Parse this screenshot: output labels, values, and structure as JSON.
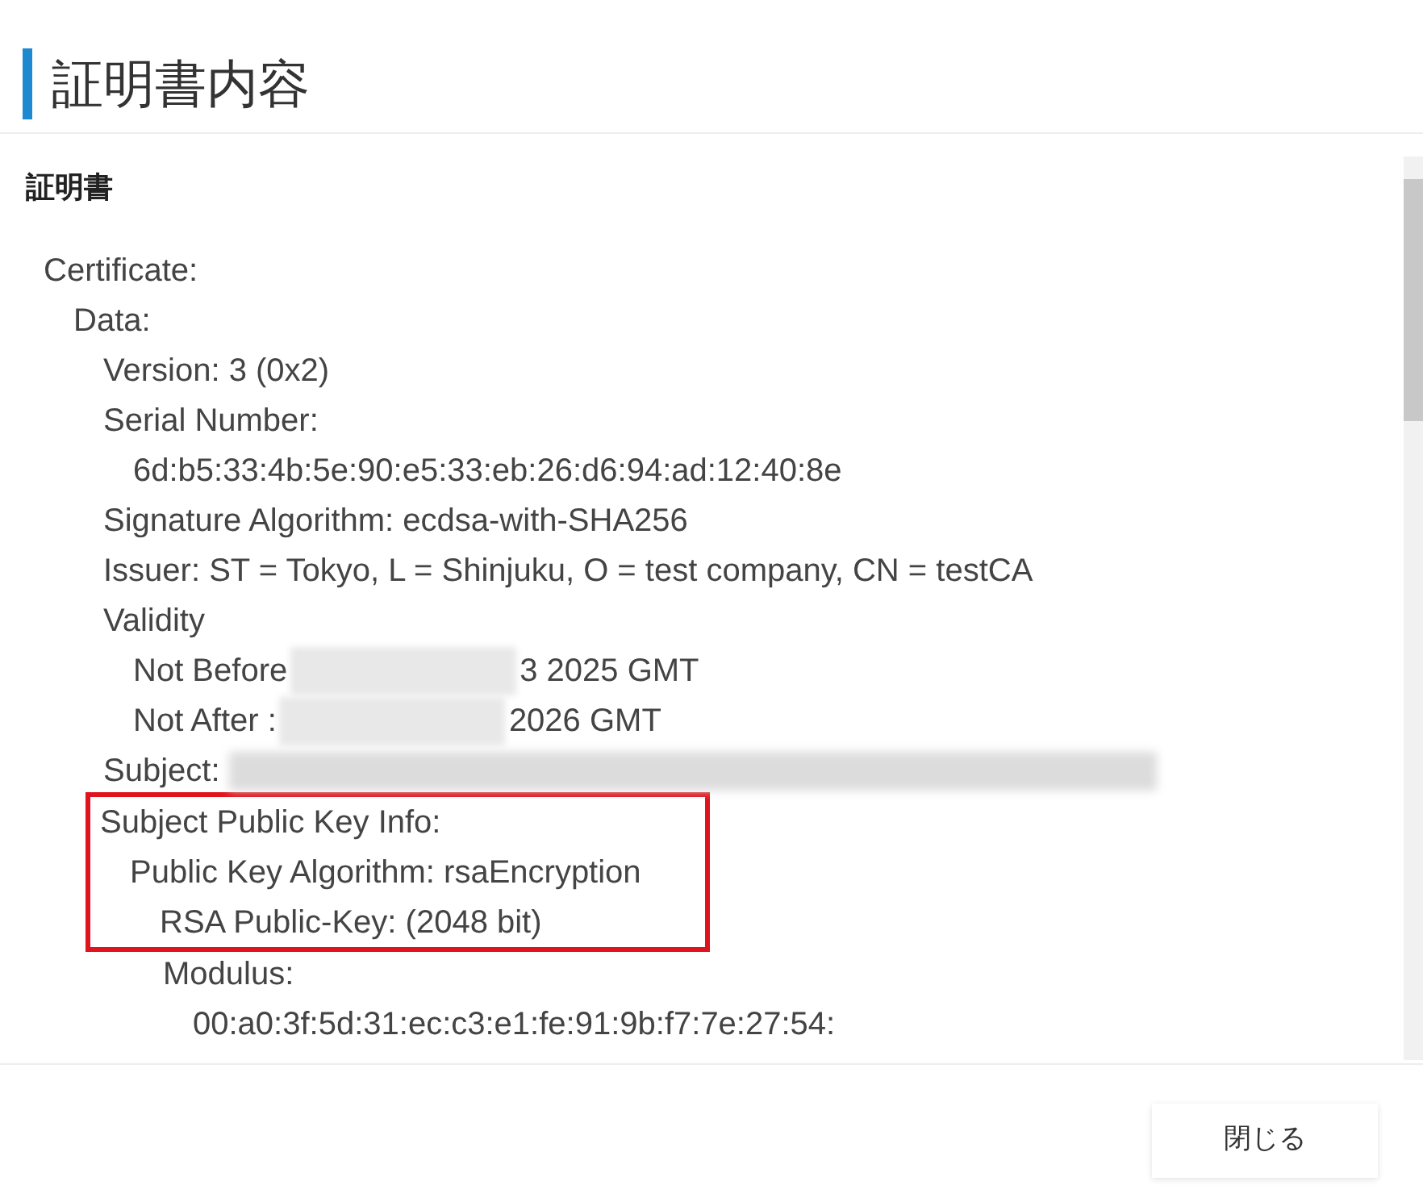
{
  "title": "証明書内容",
  "section": {
    "heading": "証明書",
    "lines": [
      {
        "parts": [
          {
            "kind": "text",
            "text": "Certificate:"
          }
        ],
        "highlighted": false,
        "children": [
          {
            "parts": [
              {
                "kind": "text",
                "text": "Data:"
              }
            ],
            "highlighted": false,
            "children": [
              {
                "parts": [
                  {
                    "kind": "text",
                    "text": "Version: 3 (0x2)"
                  }
                ],
                "highlighted": false
              },
              {
                "parts": [
                  {
                    "kind": "text",
                    "text": "Serial Number:"
                  }
                ],
                "highlighted": false,
                "children": [
                  {
                    "parts": [
                      {
                        "kind": "text",
                        "text": "6d:b5:33:4b:5e:90:e5:33:eb:26:d6:94:ad:12:40:8e"
                      }
                    ],
                    "highlighted": false
                  }
                ]
              },
              {
                "parts": [
                  {
                    "kind": "text",
                    "text": "Signature Algorithm: ecdsa-with-SHA256"
                  }
                ],
                "highlighted": false
              },
              {
                "parts": [
                  {
                    "kind": "text",
                    "text": "Issuer: ST = Tokyo, L = Shinjuku, O = test company, CN = testCA"
                  }
                ],
                "highlighted": false
              },
              {
                "parts": [
                  {
                    "kind": "text",
                    "text": "Validity"
                  }
                ],
                "highlighted": false,
                "children": [
                  {
                    "parts": [
                      {
                        "kind": "text",
                        "text": "Not Before"
                      },
                      {
                        "kind": "redaction"
                      },
                      {
                        "kind": "text",
                        "text": "3 2025 GMT"
                      }
                    ],
                    "highlighted": false
                  },
                  {
                    "parts": [
                      {
                        "kind": "text",
                        "text": "Not After :"
                      },
                      {
                        "kind": "redaction"
                      },
                      {
                        "kind": "text",
                        "text": "2026 GMT"
                      }
                    ],
                    "highlighted": false
                  }
                ]
              },
              {
                "parts": [
                  {
                    "kind": "text",
                    "text": "Subject:"
                  },
                  {
                    "kind": "redaction_long"
                  }
                ],
                "highlighted": false
              },
              {
                "parts": [
                  {
                    "kind": "text",
                    "text": "Subject Public Key Info:"
                  }
                ],
                "highlighted": true,
                "children": [
                  {
                    "parts": [
                      {
                        "kind": "text",
                        "text": "Public Key Algorithm: rsaEncryption"
                      }
                    ],
                    "highlighted": true,
                    "children": [
                      {
                        "parts": [
                          {
                            "kind": "text",
                            "text": "RSA Public-Key: (2048 bit)"
                          }
                        ],
                        "highlighted": true
                      },
                      {
                        "parts": [
                          {
                            "kind": "text",
                            "text": "Modulus:"
                          }
                        ],
                        "highlighted": false,
                        "children": [
                          {
                            "parts": [
                              {
                                "kind": "text",
                                "text": "00:a0:3f:5d:31:ec:c3:e1:fe:91:9b:f7:7e:27:54:"
                              }
                            ],
                            "highlighted": false
                          }
                        ]
                      }
                    ]
                  }
                ]
              }
            ]
          }
        ]
      }
    ]
  },
  "close_button": "閉じる"
}
